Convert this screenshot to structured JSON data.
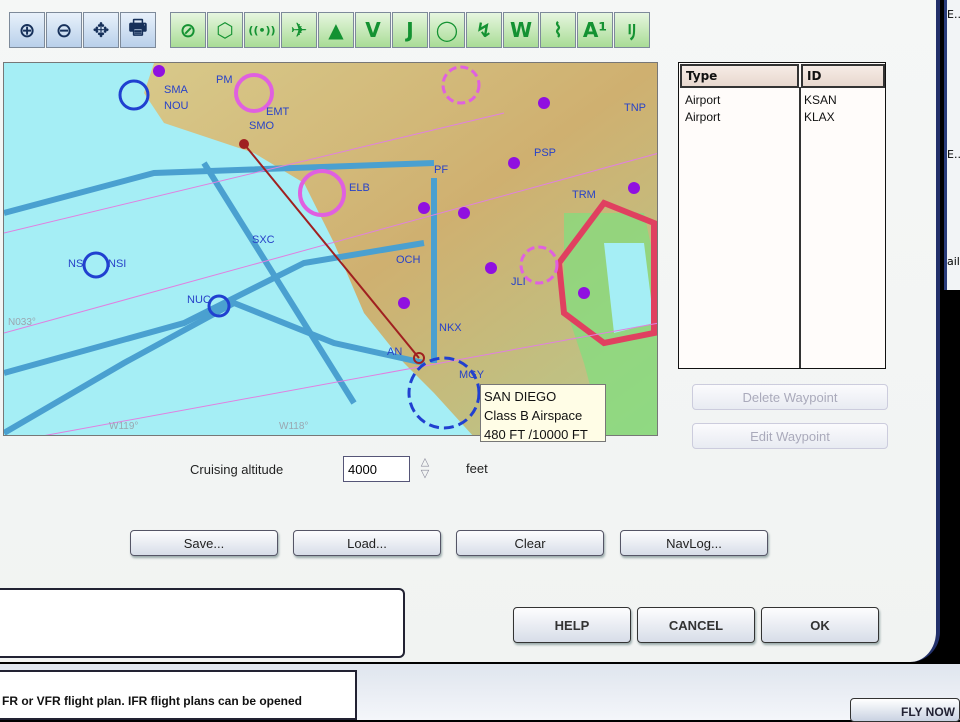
{
  "toolbar": {
    "view_tools": [
      {
        "icon": "zoom-in-icon",
        "glyph": "⊕"
      },
      {
        "icon": "zoom-out-icon",
        "glyph": "⊖"
      },
      {
        "icon": "center-icon",
        "glyph": "✥"
      },
      {
        "icon": "print-icon",
        "glyph": "🖶"
      }
    ],
    "layer_tools": [
      {
        "icon": "airport-layer-icon",
        "glyph": "⊘"
      },
      {
        "icon": "vor-layer-icon",
        "glyph": "⬡"
      },
      {
        "icon": "ndb-layer-icon",
        "glyph": "((•))"
      },
      {
        "icon": "intersection-layer-icon",
        "glyph": "✈"
      },
      {
        "icon": "terrain-layer-icon",
        "glyph": "▲"
      },
      {
        "icon": "victor-airways-icon",
        "glyph": "V"
      },
      {
        "icon": "jet-airways-icon",
        "glyph": "J"
      },
      {
        "icon": "airspace-layer-icon",
        "glyph": "◯"
      },
      {
        "icon": "route-layer-icon",
        "glyph": "↯"
      },
      {
        "icon": "weather-layer-icon",
        "glyph": "W"
      },
      {
        "icon": "high-low-icon",
        "glyph": "⌇"
      },
      {
        "icon": "altitude-labels-icon",
        "glyph": "A¹"
      },
      {
        "icon": "boundaries-icon",
        "glyph": "ﾘ"
      }
    ]
  },
  "map": {
    "labels": [
      "SMA",
      "NOU",
      "PM",
      "EMT",
      "SMO",
      "ELB",
      "TNP",
      "PSP",
      "TRM",
      "SXC",
      "NSI",
      "NSI",
      "NUC",
      "JLI",
      "NKX",
      "AN",
      "OCH",
      "PF",
      "MGY"
    ],
    "grid_labels": [
      "N033°",
      "W119°",
      "W118°"
    ],
    "tooltip": {
      "name": "SAN DIEGO",
      "class": "Class B Airspace",
      "altitudes": "480 FT /10000 FT"
    }
  },
  "waypoints": {
    "columns": [
      "Type",
      "ID"
    ],
    "rows": [
      {
        "type": "Airport",
        "id": "KSAN"
      },
      {
        "type": "Airport",
        "id": "KLAX"
      }
    ]
  },
  "buttons": {
    "delete_waypoint": "Delete Waypoint",
    "edit_waypoint": "Edit Waypoint",
    "save": "Save...",
    "load": "Load...",
    "clear": "Clear",
    "navlog": "NavLog...",
    "help": "HELP",
    "cancel": "CANCEL",
    "ok": "OK",
    "fly_now": "FLY NOW"
  },
  "altitude": {
    "label": "Cruising altitude",
    "value": "4000",
    "unit": "feet"
  },
  "background_text": "FR or VFR flight plan. IFR flight plans can be opened",
  "side_window": {
    "items": [
      "E...",
      "E...",
      "ail"
    ]
  }
}
